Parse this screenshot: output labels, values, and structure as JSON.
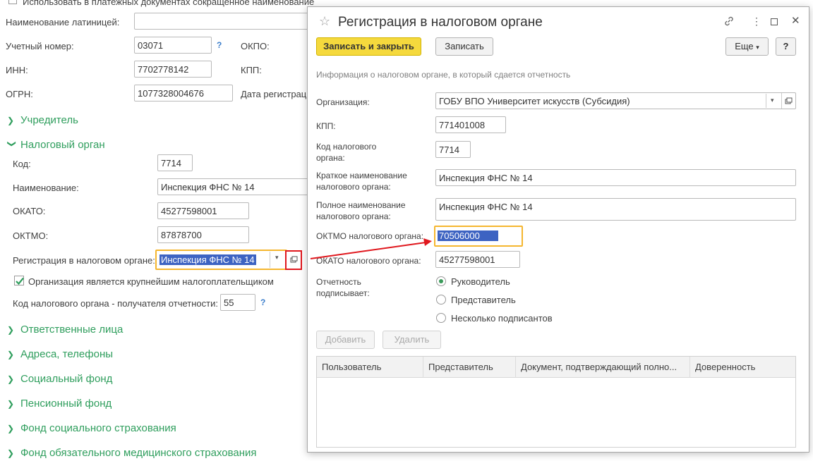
{
  "bg": {
    "top_checkbox_label": "Использовать в платежных документах сокращенное наименование",
    "latin_name_label": "Наименование латиницей:",
    "account_label": "Учетный номер:",
    "account_value": "03071",
    "okpo_label": "ОКПО:",
    "inn_label": "ИНН:",
    "inn_value": "7702778142",
    "kpp_label": "КПП:",
    "ogrn_label": "ОГРН:",
    "ogrn_value": "1077328004676",
    "reg_date_label": "Дата регистрац",
    "help_mark": "?",
    "sections": {
      "founder": "Учредитель",
      "tax_authority": "Налоговый орган",
      "responsible": "Ответственные лица",
      "addresses": "Адреса, телефоны",
      "social_fund": "Социальный фонд",
      "pension_fund": "Пенсионный фонд",
      "social_insurance": "Фонд социального страхования",
      "medical_insurance": "Фонд обязательного медицинского страхования"
    },
    "tax": {
      "code_label": "Код:",
      "code_value": "7714",
      "name_label": "Наименование:",
      "name_value": "Инспекция ФНС № 14",
      "okato_label": "ОКАТО:",
      "okato_value": "45277598001",
      "oktmo_label": "ОКТМО:",
      "oktmo_value": "87878700",
      "registration_label": "Регистрация в налоговом органе:",
      "registration_value": "Инспекция ФНС № 14",
      "largest_taxpayer_label": "Организация является крупнейшим налогоплательщиком",
      "recipient_code_label": "Код налогового органа - получателя отчетности:",
      "recipient_code_value": "55"
    }
  },
  "dialog": {
    "title": "Регистрация в налоговом органе",
    "save_close_label": "Записать и закрыть",
    "save_label": "Записать",
    "more_label": "Еще",
    "help_label": "?",
    "info": "Информация о налоговом органе, в который сдается отчетность",
    "org_label": "Организация:",
    "org_value": "ГОБУ ВПО Университет искусств (Субсидия)",
    "kpp_label": "КПП:",
    "kpp_value": "771401008",
    "code_label": "Код налогового органа:",
    "code_value": "7714",
    "short_name_label": "Краткое наименование налогового органа:",
    "short_name_value": "Инспекция ФНС № 14",
    "full_name_label": "Полное наименование налогового органа:",
    "full_name_value": "Инспекция ФНС № 14",
    "oktmo_label": "ОКТМО налогового органа:",
    "oktmo_value": "70506000",
    "okato_label": "ОКАТО налогового органа:",
    "okato_value": "45277598001",
    "signer_label": "Отчетность подписывает:",
    "signer_options": [
      "Руководитель",
      "Представитель",
      "Несколько подписантов"
    ],
    "add_label": "Добавить",
    "delete_label": "Удалить",
    "columns": [
      "Пользователь",
      "Представитель",
      "Документ, подтверждающий полно...",
      "Доверенность"
    ]
  },
  "colors": {
    "accent_green": "#2f9e5d",
    "highlight_orange": "#f5b62f",
    "arrow_red": "#e0181e",
    "primary_yellow": "#f5d93d"
  }
}
